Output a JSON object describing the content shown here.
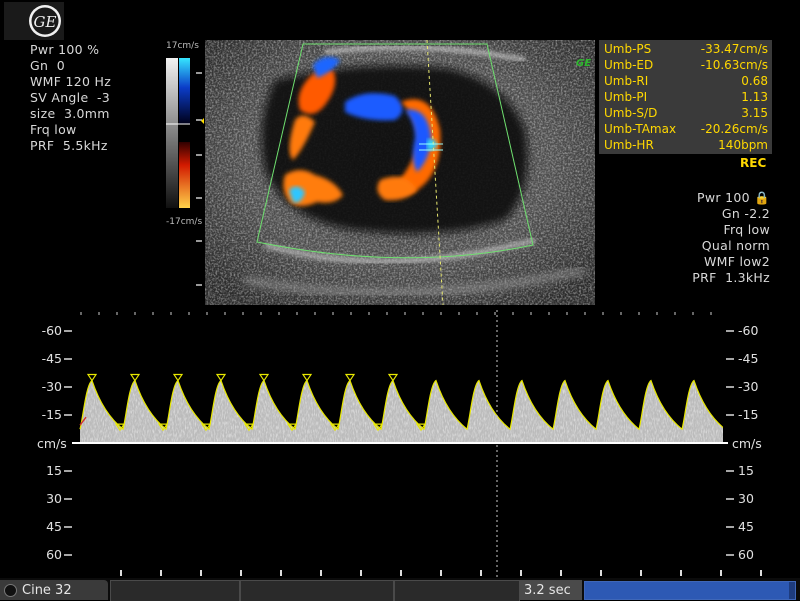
{
  "logo": {
    "text": "GE"
  },
  "left_params": [
    "Pwr 100 %",
    "Gn  0",
    "WMF 120 Hz",
    "SV Angle  -3",
    "size  3.0mm",
    "Frq low",
    "PRF  5.5kHz"
  ],
  "color_bar": {
    "top_label": "17cm/s",
    "bottom_label": "-17cm/s"
  },
  "measurements": [
    {
      "label": "Umb-PS",
      "value": "-33.47cm/s"
    },
    {
      "label": "Umb-ED",
      "value": "-10.63cm/s"
    },
    {
      "label": "Umb-RI",
      "value": "0.68"
    },
    {
      "label": "Umb-PI",
      "value": "1.13"
    },
    {
      "label": "Umb-S/D",
      "value": "3.15"
    },
    {
      "label": "Umb-TAmax",
      "value": "-20.26cm/s"
    },
    {
      "label": "Umb-HR",
      "value": "140bpm"
    }
  ],
  "ge_tag": "GE",
  "rec_label": "REC",
  "right_params": [
    "Pwr 100 🔒",
    "Gn -2.2",
    "Frq low",
    "Qual norm",
    "WMF low2",
    "PRF  1.3kHz"
  ],
  "doppler": {
    "scale_unit": "cm/s",
    "ticks_above": [
      "-60",
      "-45",
      "-30",
      "-15"
    ],
    "ticks_below": [
      "15",
      "30",
      "45",
      "60"
    ]
  },
  "bottom": {
    "cine_label": "Cine 32",
    "time_label": "3.2 sec",
    "progress": 0.97
  },
  "colors": {
    "measure_text": "#ffd800",
    "trace": "#e8e800",
    "baseline": "#ffffff",
    "progress": "#2d59b4"
  }
}
